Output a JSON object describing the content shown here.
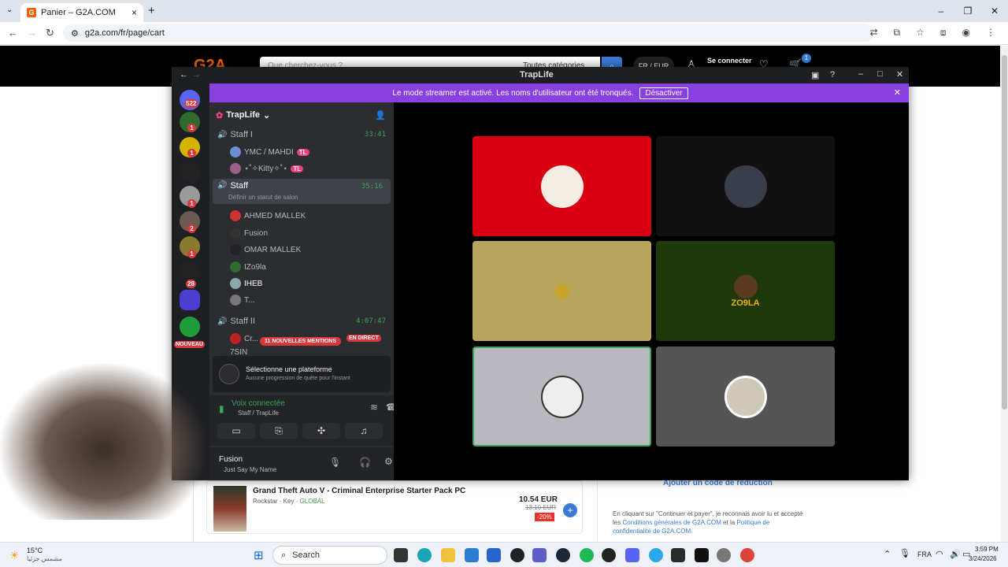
{
  "browser": {
    "tab_title": "Panier – G2A.COM",
    "url": "g2a.com/fr/page/cart"
  },
  "g2a": {
    "search_placeholder": "Que cherchez-vous ?",
    "category": "Toutes catégories",
    "lang": "FR / EUR",
    "login": "Se connecter",
    "cart_count": "1",
    "product_title": "Grand Theft Auto V - Criminal Enterprise Starter Pack PC",
    "publisher": "Rockstar",
    "key_label": "Key",
    "region": "GLOBAL",
    "price": "10.54 EUR",
    "old_price": "13.10 EUR",
    "discount": "-20%",
    "promo_link": "Ajouter un code de réduction",
    "legal_text_1": "En cliquant sur \"Continuer et payer\", je reconnais avoir lu et accepté les",
    "legal_link_1": "Conditions générales de G2A.COM",
    "legal_and": "et la",
    "legal_link_2": "Politique de confidentialité de G2A.COM."
  },
  "discord": {
    "window_title": "TrapLife",
    "banner_text": "Le mode streamer est activé. Les noms d'utilisateur ont été tronqués.",
    "banner_button": "Désactiver",
    "server_name": "TrapLife",
    "dm_badge": "522",
    "rail_badges": [
      "1",
      "1",
      "1",
      "1",
      "2",
      "1",
      "28"
    ],
    "new_label": "NOUVEAU",
    "channels": [
      {
        "name": "Staff I",
        "time": "33:41"
      },
      {
        "name": "Staff",
        "time": "35:16",
        "status": "Définir un statut de salon"
      },
      {
        "name": "Staff II",
        "time": "4:07:47"
      }
    ],
    "staff1_members": [
      "YMC / MAHDI",
      "⋆˚✧Kitty✧˚⋆"
    ],
    "staff_members": [
      "AHMED MALLEK",
      "Fusion",
      "OMAR MALLEK",
      "IZo9la",
      "IHEB",
      "T..."
    ],
    "staff2_members": [
      "Cr...",
      "7SIN"
    ],
    "tl_tag": "TL",
    "mentions_pill": "11 NOUVELLES MENTIONS",
    "live_pill": "EN DIRECT",
    "quest_title": "Sélectionne une plateforme",
    "quest_sub": "Aucune progression de quête pour l'instant",
    "voice_status": "Voix connectée",
    "voice_channel": "Staff / TrapLife",
    "user_name": "Fusion",
    "user_status": "Just Say My Name",
    "tile_colors": [
      "#d9000f",
      "#111111",
      "#b7a55d",
      "#1f3a0a",
      "#b8b8be",
      "#555555"
    ],
    "tile_label_4": "ZO9LA"
  },
  "taskbar": {
    "weather_temp": "15°C",
    "weather_text": "مشمس جزئيا",
    "search": "Search",
    "lang": "FRA",
    "time": "3:59 PM",
    "date": "3/24/2026"
  }
}
